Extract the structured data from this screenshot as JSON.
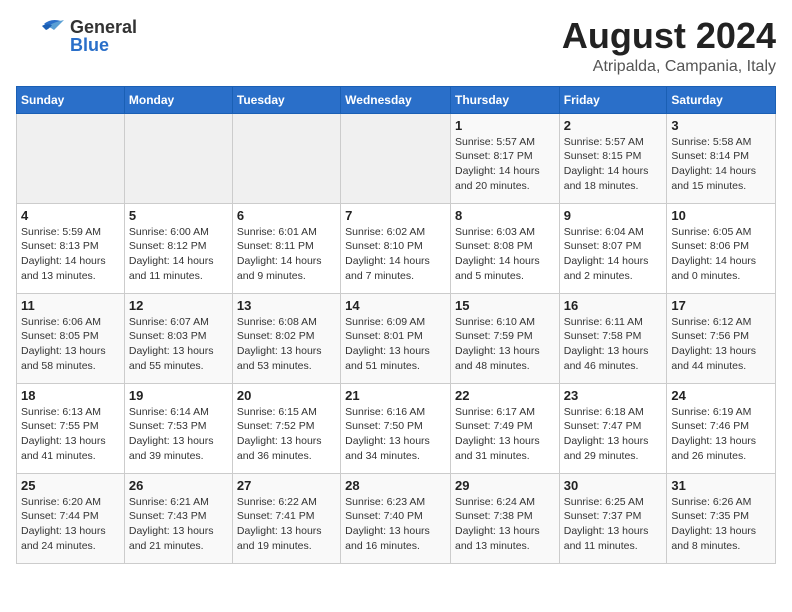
{
  "header": {
    "logo": {
      "line1": "General",
      "line2": "Blue"
    },
    "title": "August 2024",
    "subtitle": "Atripalda, Campania, Italy"
  },
  "calendar": {
    "days_of_week": [
      "Sunday",
      "Monday",
      "Tuesday",
      "Wednesday",
      "Thursday",
      "Friday",
      "Saturday"
    ],
    "weeks": [
      [
        {
          "day": "",
          "info": ""
        },
        {
          "day": "",
          "info": ""
        },
        {
          "day": "",
          "info": ""
        },
        {
          "day": "",
          "info": ""
        },
        {
          "day": "1",
          "info": "Sunrise: 5:57 AM\nSunset: 8:17 PM\nDaylight: 14 hours\nand 20 minutes."
        },
        {
          "day": "2",
          "info": "Sunrise: 5:57 AM\nSunset: 8:15 PM\nDaylight: 14 hours\nand 18 minutes."
        },
        {
          "day": "3",
          "info": "Sunrise: 5:58 AM\nSunset: 8:14 PM\nDaylight: 14 hours\nand 15 minutes."
        }
      ],
      [
        {
          "day": "4",
          "info": "Sunrise: 5:59 AM\nSunset: 8:13 PM\nDaylight: 14 hours\nand 13 minutes."
        },
        {
          "day": "5",
          "info": "Sunrise: 6:00 AM\nSunset: 8:12 PM\nDaylight: 14 hours\nand 11 minutes."
        },
        {
          "day": "6",
          "info": "Sunrise: 6:01 AM\nSunset: 8:11 PM\nDaylight: 14 hours\nand 9 minutes."
        },
        {
          "day": "7",
          "info": "Sunrise: 6:02 AM\nSunset: 8:10 PM\nDaylight: 14 hours\nand 7 minutes."
        },
        {
          "day": "8",
          "info": "Sunrise: 6:03 AM\nSunset: 8:08 PM\nDaylight: 14 hours\nand 5 minutes."
        },
        {
          "day": "9",
          "info": "Sunrise: 6:04 AM\nSunset: 8:07 PM\nDaylight: 14 hours\nand 2 minutes."
        },
        {
          "day": "10",
          "info": "Sunrise: 6:05 AM\nSunset: 8:06 PM\nDaylight: 14 hours\nand 0 minutes."
        }
      ],
      [
        {
          "day": "11",
          "info": "Sunrise: 6:06 AM\nSunset: 8:05 PM\nDaylight: 13 hours\nand 58 minutes."
        },
        {
          "day": "12",
          "info": "Sunrise: 6:07 AM\nSunset: 8:03 PM\nDaylight: 13 hours\nand 55 minutes."
        },
        {
          "day": "13",
          "info": "Sunrise: 6:08 AM\nSunset: 8:02 PM\nDaylight: 13 hours\nand 53 minutes."
        },
        {
          "day": "14",
          "info": "Sunrise: 6:09 AM\nSunset: 8:01 PM\nDaylight: 13 hours\nand 51 minutes."
        },
        {
          "day": "15",
          "info": "Sunrise: 6:10 AM\nSunset: 7:59 PM\nDaylight: 13 hours\nand 48 minutes."
        },
        {
          "day": "16",
          "info": "Sunrise: 6:11 AM\nSunset: 7:58 PM\nDaylight: 13 hours\nand 46 minutes."
        },
        {
          "day": "17",
          "info": "Sunrise: 6:12 AM\nSunset: 7:56 PM\nDaylight: 13 hours\nand 44 minutes."
        }
      ],
      [
        {
          "day": "18",
          "info": "Sunrise: 6:13 AM\nSunset: 7:55 PM\nDaylight: 13 hours\nand 41 minutes."
        },
        {
          "day": "19",
          "info": "Sunrise: 6:14 AM\nSunset: 7:53 PM\nDaylight: 13 hours\nand 39 minutes."
        },
        {
          "day": "20",
          "info": "Sunrise: 6:15 AM\nSunset: 7:52 PM\nDaylight: 13 hours\nand 36 minutes."
        },
        {
          "day": "21",
          "info": "Sunrise: 6:16 AM\nSunset: 7:50 PM\nDaylight: 13 hours\nand 34 minutes."
        },
        {
          "day": "22",
          "info": "Sunrise: 6:17 AM\nSunset: 7:49 PM\nDaylight: 13 hours\nand 31 minutes."
        },
        {
          "day": "23",
          "info": "Sunrise: 6:18 AM\nSunset: 7:47 PM\nDaylight: 13 hours\nand 29 minutes."
        },
        {
          "day": "24",
          "info": "Sunrise: 6:19 AM\nSunset: 7:46 PM\nDaylight: 13 hours\nand 26 minutes."
        }
      ],
      [
        {
          "day": "25",
          "info": "Sunrise: 6:20 AM\nSunset: 7:44 PM\nDaylight: 13 hours\nand 24 minutes."
        },
        {
          "day": "26",
          "info": "Sunrise: 6:21 AM\nSunset: 7:43 PM\nDaylight: 13 hours\nand 21 minutes."
        },
        {
          "day": "27",
          "info": "Sunrise: 6:22 AM\nSunset: 7:41 PM\nDaylight: 13 hours\nand 19 minutes."
        },
        {
          "day": "28",
          "info": "Sunrise: 6:23 AM\nSunset: 7:40 PM\nDaylight: 13 hours\nand 16 minutes."
        },
        {
          "day": "29",
          "info": "Sunrise: 6:24 AM\nSunset: 7:38 PM\nDaylight: 13 hours\nand 13 minutes."
        },
        {
          "day": "30",
          "info": "Sunrise: 6:25 AM\nSunset: 7:37 PM\nDaylight: 13 hours\nand 11 minutes."
        },
        {
          "day": "31",
          "info": "Sunrise: 6:26 AM\nSunset: 7:35 PM\nDaylight: 13 hours\nand 8 minutes."
        }
      ]
    ]
  }
}
